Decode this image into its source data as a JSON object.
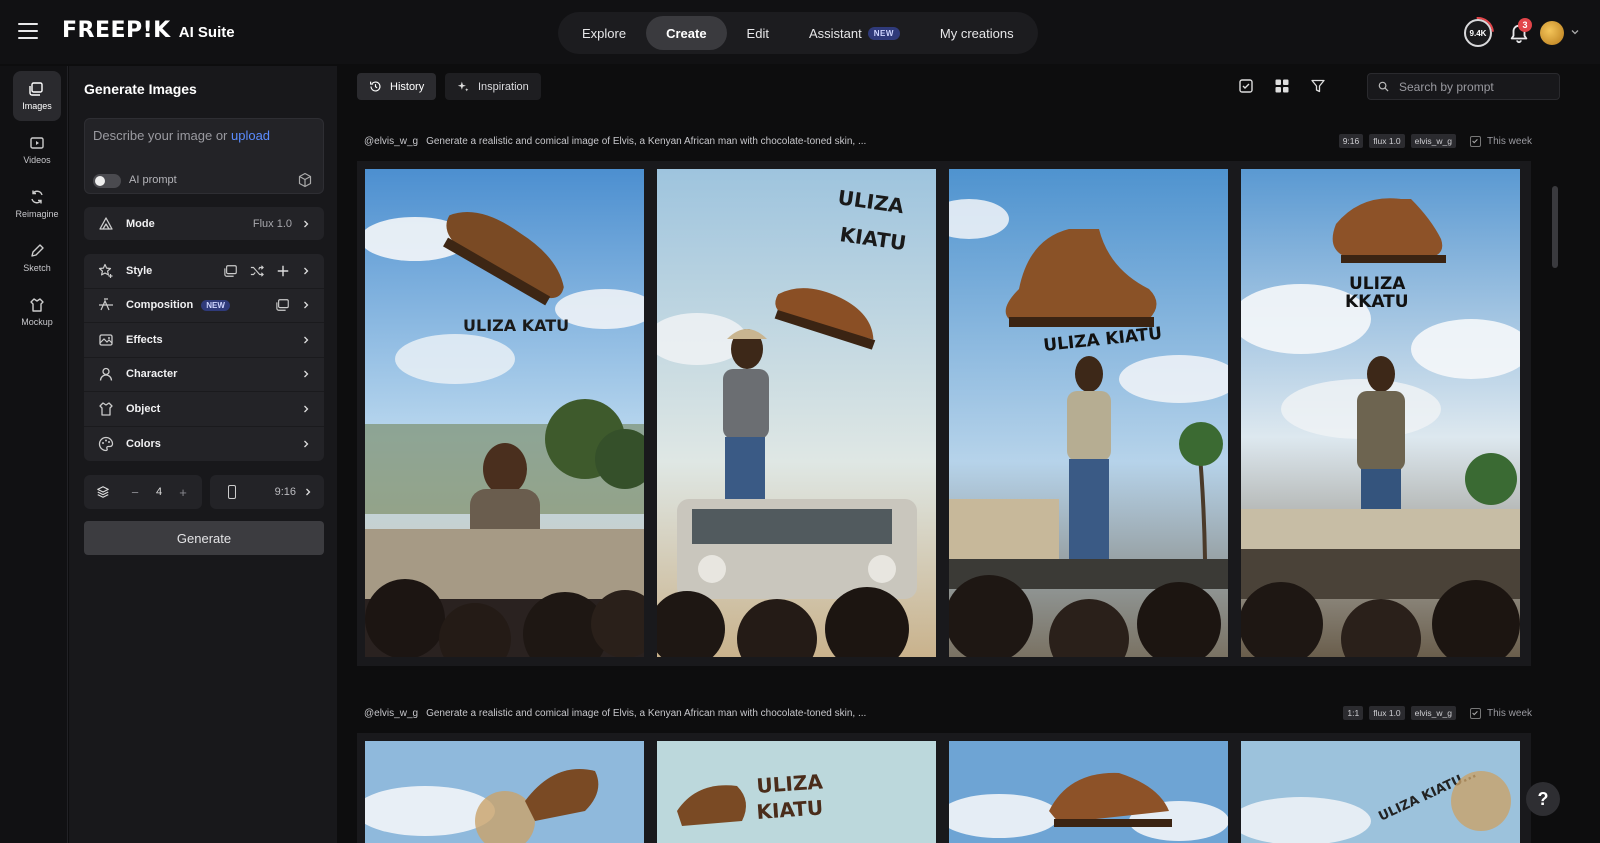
{
  "topbar": {
    "logo_word": "FREEP!K",
    "logo_suite": "AI Suite",
    "nav": [
      {
        "label": "Explore"
      },
      {
        "label": "Create"
      },
      {
        "label": "Edit"
      },
      {
        "label": "Assistant",
        "badge": "NEW"
      },
      {
        "label": "My creations"
      }
    ],
    "credits": "9.4K",
    "notifications_count": "3"
  },
  "rail": [
    {
      "label": "Images",
      "icon": "images-icon"
    },
    {
      "label": "Videos",
      "icon": "videos-icon"
    },
    {
      "label": "Reimagine",
      "icon": "reimagine-icon"
    },
    {
      "label": "Sketch",
      "icon": "sketch-icon"
    },
    {
      "label": "Mockup",
      "icon": "mockup-icon"
    }
  ],
  "panel": {
    "title": "Generate Images",
    "prompt_placeholder": "Describe your image or ",
    "prompt_upload": "upload",
    "ai_prompt_label": "AI prompt",
    "mode_label": "Mode",
    "mode_value": "Flux 1.0",
    "options": [
      {
        "label": "Style"
      },
      {
        "label": "Composition",
        "badge": "NEW"
      },
      {
        "label": "Effects"
      },
      {
        "label": "Character"
      },
      {
        "label": "Object"
      },
      {
        "label": "Colors"
      }
    ],
    "count_minus": "−",
    "count_value": "4",
    "count_plus": "+",
    "ratio_value": "9:16",
    "generate_label": "Generate"
  },
  "toolbar": {
    "history_label": "History",
    "inspiration_label": "Inspiration",
    "search_placeholder": "Search by prompt"
  },
  "generations": [
    {
      "user": "@elvis_w_g",
      "prompt": "Generate a realistic and comical image of Elvis, a Kenyan African man with chocolate-toned skin, ...",
      "tags": [
        "9:16",
        "flux 1.0",
        "elvis_w_g"
      ],
      "period": "This week",
      "image_texts": [
        "ULIZA KATU",
        "ULIZA KIATU",
        "ULIZA KIATU",
        "ULIZA KKATU"
      ]
    },
    {
      "user": "@elvis_w_g",
      "prompt": "Generate a realistic and comical image of Elvis, a Kenyan African man with chocolate-toned skin, ...",
      "tags": [
        "1:1",
        "flux 1.0",
        "elvis_w_g"
      ],
      "period": "This week",
      "image_texts": [
        "",
        "ULIZA KIATU",
        "",
        "ULIZA KIATU..."
      ]
    }
  ],
  "help_label": "?"
}
